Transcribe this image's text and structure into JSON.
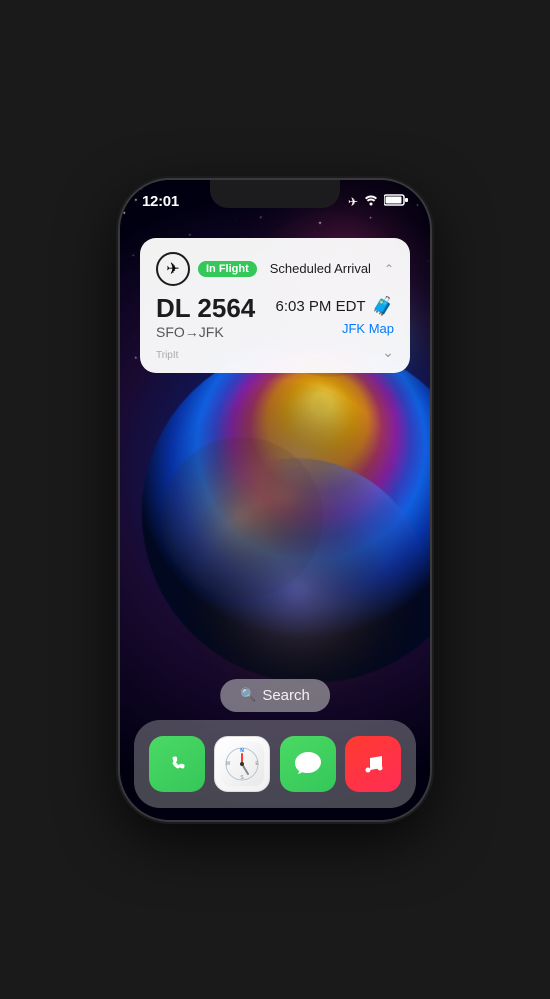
{
  "phone": {
    "status_bar": {
      "time": "12:01",
      "icons": [
        "✈",
        "wifi",
        "battery"
      ]
    },
    "notification": {
      "status_badge": "In Flight",
      "status_badge_color": "#34c759",
      "title": "Scheduled Arrival",
      "flight_number": "DL 2564",
      "route": "SFO→JFK",
      "arrival_time": "6:03 PM EDT",
      "map_link": "JFK Map",
      "app_name": "TripIt"
    },
    "search": {
      "label": "Search"
    },
    "dock": {
      "apps": [
        {
          "name": "Phone",
          "icon": "phone"
        },
        {
          "name": "Safari",
          "icon": "safari"
        },
        {
          "name": "Messages",
          "icon": "messages"
        },
        {
          "name": "Music",
          "icon": "music"
        }
      ]
    }
  }
}
